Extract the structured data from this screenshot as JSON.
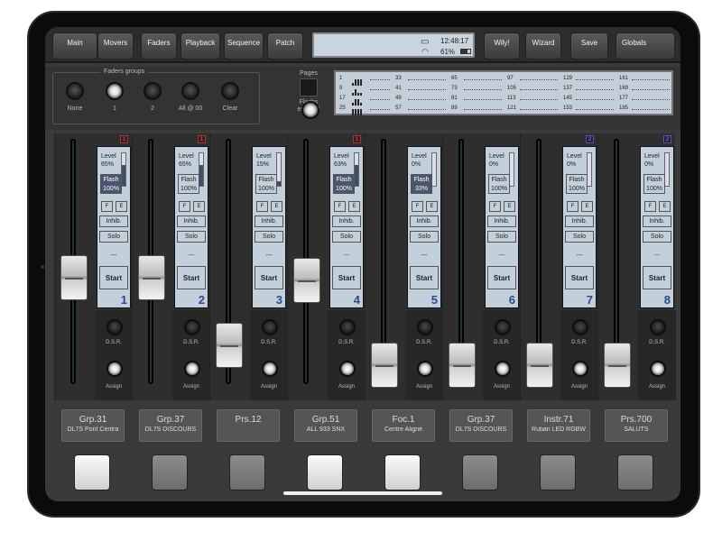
{
  "toolbar": {
    "buttons": [
      {
        "label": "Main"
      },
      {
        "label": "Movers"
      },
      {
        "label": "Faders"
      },
      {
        "label": "Playback"
      },
      {
        "label": "Sequence"
      },
      {
        "label": "Patch"
      },
      {
        "label": "Wily!"
      },
      {
        "label": "Wizard"
      },
      {
        "label": "Save"
      },
      {
        "label": "Globals"
      }
    ],
    "active": "Faders",
    "status": {
      "time": "12:48:17",
      "battery": "61%"
    },
    "globals_indicators": [
      "BO",
      "FZ",
      "PB",
      "GM"
    ],
    "colors": {
      "faders_led": "#e8e23a",
      "save_led": "#3fd0b0"
    }
  },
  "fader_groups": {
    "title": "Faders groups",
    "items": [
      {
        "label": "None",
        "lit": false
      },
      {
        "label": "1",
        "lit": true
      },
      {
        "label": "2",
        "lit": false
      },
      {
        "label": "All @ 00",
        "lit": false
      },
      {
        "label": "Clear",
        "lit": false
      }
    ],
    "pages_label": "Pages",
    "flash_label_1": "Flashs",
    "flash_label_2": "enabled"
  },
  "pages_display": [
    [
      {
        "num": "1",
        "bars": true
      },
      {
        "num": "9",
        "bars": true
      },
      {
        "num": "17",
        "bars": true
      },
      {
        "num": "25",
        "bars": true
      }
    ],
    [
      {
        "num": "33"
      },
      {
        "num": "41"
      },
      {
        "num": "49"
      },
      {
        "num": "57"
      }
    ],
    [
      {
        "num": "65"
      },
      {
        "num": "73"
      },
      {
        "num": "81"
      },
      {
        "num": "89"
      }
    ],
    [
      {
        "num": "97"
      },
      {
        "num": "105"
      },
      {
        "num": "113"
      },
      {
        "num": "121"
      }
    ],
    [
      {
        "num": "129"
      },
      {
        "num": "137"
      },
      {
        "num": "145"
      },
      {
        "num": "153"
      }
    ],
    [
      {
        "num": "161"
      },
      {
        "num": "169"
      },
      {
        "num": "177"
      },
      {
        "num": "185"
      }
    ]
  ],
  "strip_labels": {
    "level": "Level",
    "flash": "Flash",
    "f": "F",
    "e": "E",
    "inhib": "Inhib.",
    "solo": "Solo",
    "dashes": "---",
    "start": "Start",
    "dsr": "D.S.R.",
    "assign": "Assign"
  },
  "faders": [
    {
      "index": "1",
      "level": "65%",
      "level_value": 0.65,
      "flash": "100%",
      "flash_on": true,
      "badge": "1",
      "badge_color": "red",
      "fader_pos": 0.65,
      "name": "Grp.31",
      "sub": "DL7S Pont Centra",
      "pad_lit": true
    },
    {
      "index": "2",
      "level": "65%",
      "level_value": 0.65,
      "flash": "100%",
      "flash_on": false,
      "badge": "1",
      "badge_color": "red",
      "fader_pos": 0.65,
      "name": "Grp.37",
      "sub": "DL7S DISCOURS",
      "pad_lit": false
    },
    {
      "index": "3",
      "level": "15%",
      "level_value": 0.15,
      "flash": "100%",
      "flash_on": false,
      "badge": "",
      "badge_color": "",
      "fader_pos": 0.15,
      "name": "Prs.12",
      "sub": "",
      "pad_lit": false
    },
    {
      "index": "4",
      "level": "63%",
      "level_value": 0.63,
      "flash": "100%",
      "flash_on": true,
      "badge": "1",
      "badge_color": "red",
      "fader_pos": 0.63,
      "name": "Grp.51",
      "sub": "ALL 933 SNX",
      "pad_lit": true
    },
    {
      "index": "5",
      "level": "0%",
      "level_value": 0.0,
      "flash": "33%",
      "flash_on": true,
      "badge": "",
      "badge_color": "",
      "fader_pos": 0.0,
      "name": "Foc.1",
      "sub": "Centre Aligné",
      "pad_lit": true
    },
    {
      "index": "6",
      "level": "0%",
      "level_value": 0.0,
      "flash": "100%",
      "flash_on": false,
      "badge": "",
      "badge_color": "",
      "fader_pos": 0.0,
      "name": "Grp.37",
      "sub": "DL7S DISCOURS",
      "pad_lit": false
    },
    {
      "index": "7",
      "level": "0%",
      "level_value": 0.0,
      "flash": "100%",
      "flash_on": false,
      "badge": "2",
      "badge_color": "blue",
      "fader_pos": 0.0,
      "name": "Instr.71",
      "sub": "Ruban LED RGBW",
      "pad_lit": false
    },
    {
      "index": "8",
      "level": "0%",
      "level_value": 0.0,
      "flash": "100%",
      "flash_on": false,
      "badge": "2",
      "badge_color": "blue",
      "fader_pos": 0.0,
      "name": "Prs.700",
      "sub": "SALUTS",
      "pad_lit": false
    }
  ]
}
